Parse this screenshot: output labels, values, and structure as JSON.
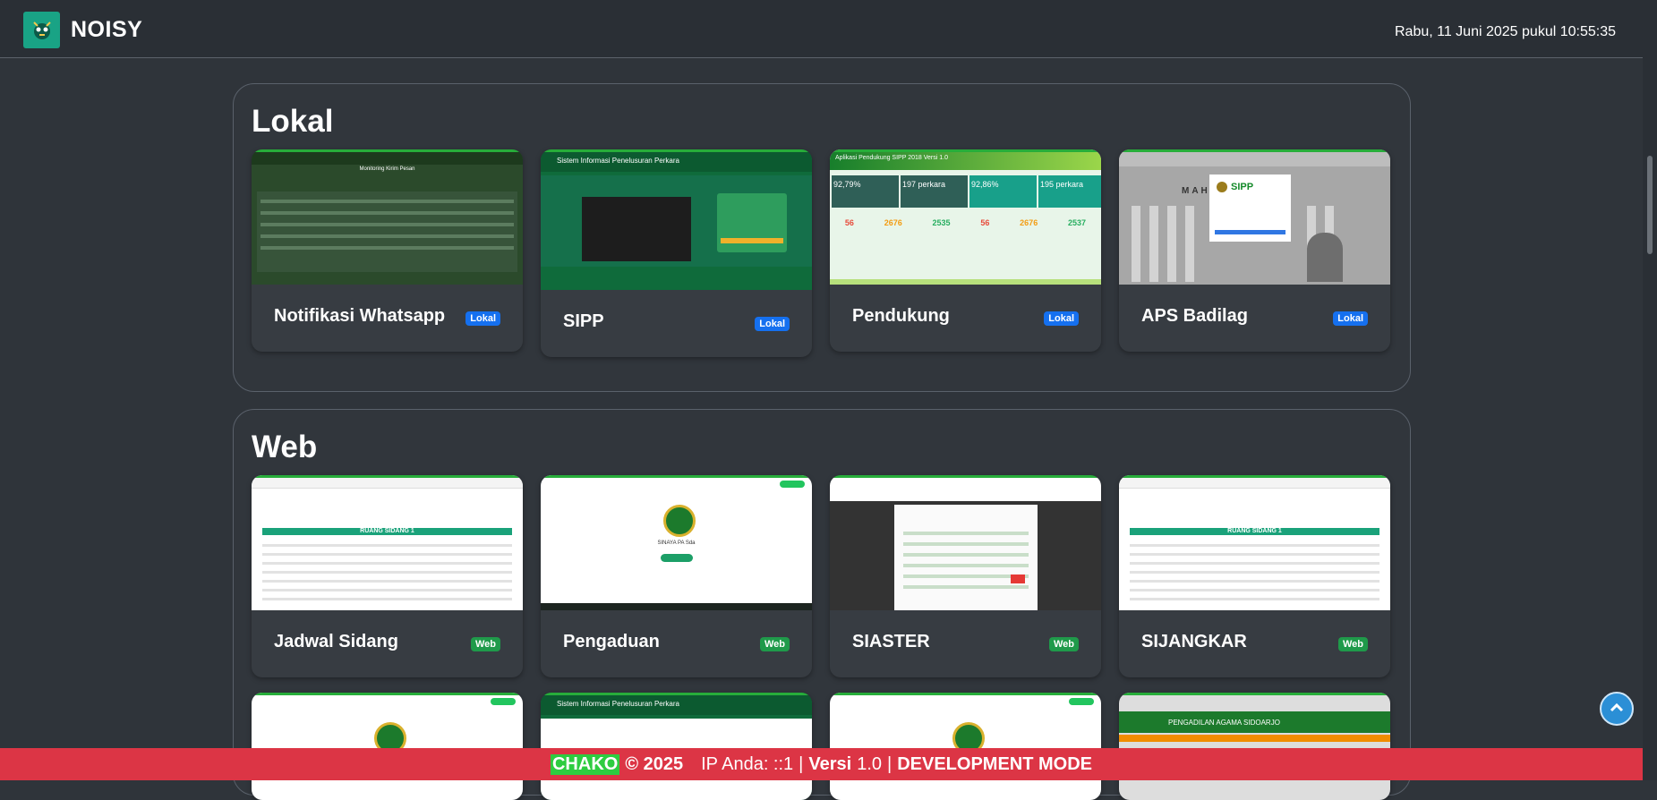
{
  "navbar": {
    "brand": "NOISY",
    "datetime": "Rabu, 11 Juni 2025 pukul 10:55:35"
  },
  "sections": [
    {
      "title": "Lokal",
      "cards": [
        {
          "title": "Notifikasi Whatsapp",
          "badge": "Lokal"
        },
        {
          "title": "SIPP",
          "badge": "Lokal"
        },
        {
          "title": "Pendukung",
          "badge": "Lokal"
        },
        {
          "title": "APS Badilag",
          "badge": "Lokal"
        }
      ]
    },
    {
      "title": "Web",
      "cards": [
        {
          "title": "Jadwal Sidang",
          "badge": "Web"
        },
        {
          "title": "Pengaduan",
          "badge": "Web"
        },
        {
          "title": "SIASTER",
          "badge": "Web"
        },
        {
          "title": "SIJANGKAR",
          "badge": "Web"
        }
      ]
    }
  ],
  "thumbs": {
    "notif_title": "Monitoring Kirim Pesan",
    "sipp_title": "Sistem Informasi Penelusuran Perkara",
    "pendukung_title": "Aplikasi Pendukung SIPP 2018 Versi 1.0",
    "pendukung_stats": [
      "92,79%",
      "197 perkara",
      "92,86%",
      "195 perkara"
    ],
    "pendukung_numbers": [
      "56",
      "2676",
      "2535",
      "56",
      "2676",
      "2537"
    ],
    "aps_label": "SIPP",
    "aps_wall": "MAHKAM",
    "ruang_sidang": "RUANG SIDANG 1",
    "sinaya": "SINAYA PA Sda",
    "row3_sipp_title": "Sistem Informasi Penelusuran Perkara",
    "row3_pa_title": "PENGADILAN AGAMA SIDOARJO"
  },
  "footer": {
    "chako": "CHAKO",
    "copyright": "© 2025",
    "ip": "IP Anda: ::1",
    "versi_label": "Versi",
    "versi_value": "1.0",
    "mode": "DEVELOPMENT MODE"
  },
  "icons": {
    "back_to_top": "chevron-up-icon",
    "logo": "brand-logo-icon"
  },
  "colors": {
    "badge_lokal": "#1570ef",
    "badge_web": "#1f9a4a",
    "footer": "#dc3545",
    "chako": "#2ecc40"
  }
}
